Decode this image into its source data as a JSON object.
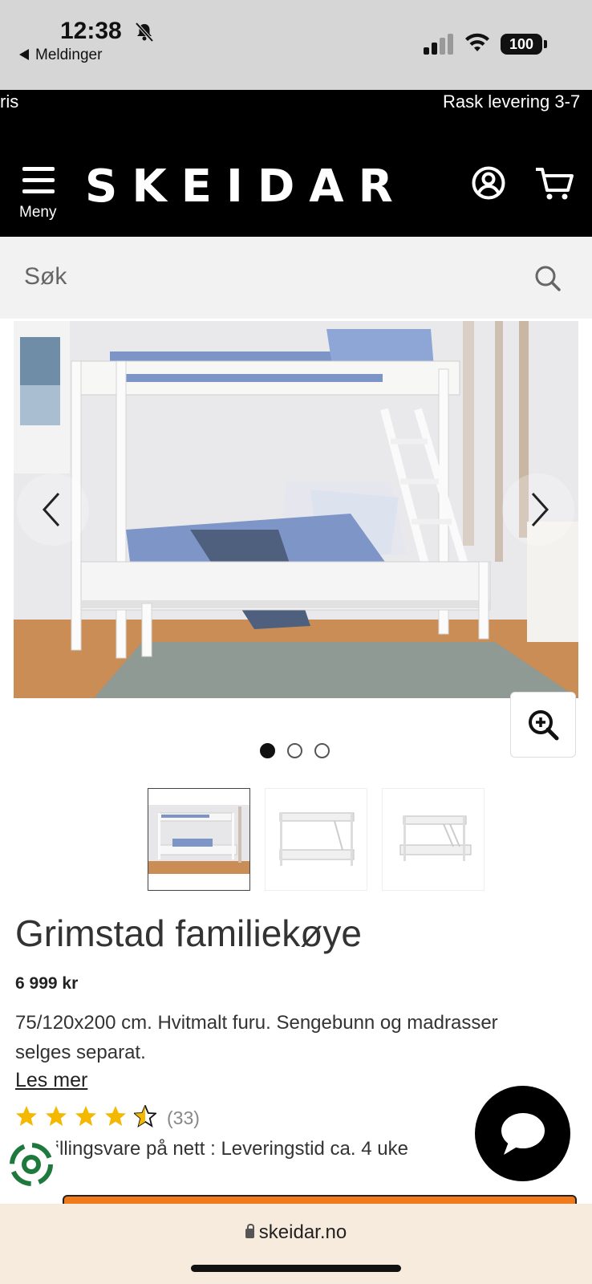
{
  "status_bar": {
    "time": "12:38",
    "back_label": "Meldinger",
    "battery": "100",
    "icons": [
      "bell-slash-icon",
      "signal-icon",
      "wifi-icon",
      "battery-icon"
    ]
  },
  "promo": {
    "left_fragment": "ris",
    "right_fragment": "Rask levering 3-7"
  },
  "header": {
    "menu_label": "Meny",
    "logo": "SKEIDAR",
    "icons": [
      "menu-icon",
      "account-icon",
      "cart-icon"
    ]
  },
  "search": {
    "placeholder": "Søk",
    "icon": "search-icon"
  },
  "gallery": {
    "dot_count": 3,
    "active_dot": 1,
    "thumbnail_count": 3,
    "active_thumbnail": 1,
    "icons": [
      "chevron-left-icon",
      "chevron-right-icon",
      "zoom-in-icon"
    ]
  },
  "product": {
    "title": "Grimstad familiekøye",
    "price": "6 999 kr",
    "description": "75/120x200 cm. Hvitmalt furu. Sengebunn og madrasser selges separat.",
    "read_more": "Les mer",
    "rating": 4.5,
    "review_count": "(33)",
    "delivery_text": "tillingsvare på nett : Leveringstid ca. 4 uke"
  },
  "browser": {
    "url": "skeidar.no"
  },
  "colors": {
    "header_bg": "#000000",
    "accent_orange": "#f07a1a",
    "star_gold": "#f5b800",
    "eco_green": "#1e7a3c"
  }
}
